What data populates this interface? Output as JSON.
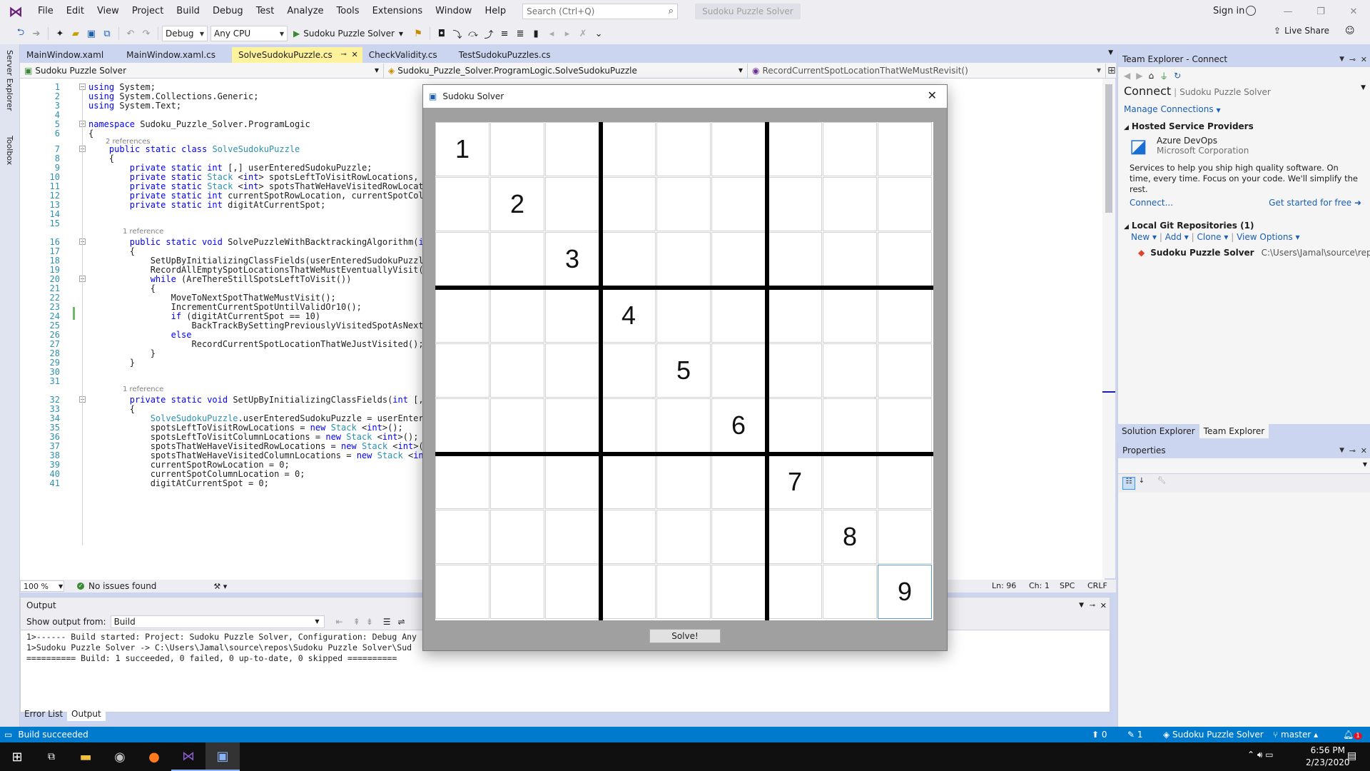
{
  "titlebar": {
    "menu": [
      "File",
      "Edit",
      "View",
      "Project",
      "Build",
      "Debug",
      "Test",
      "Analyze",
      "Tools",
      "Extensions",
      "Window",
      "Help"
    ],
    "search_placeholder": "Search (Ctrl+Q)",
    "solution_badge": "Sudoku Puzzle Solver",
    "sign_in": "Sign in"
  },
  "toolbar": {
    "config": "Debug",
    "platform": "Any CPU",
    "start_target": "Sudoku Puzzle Solver",
    "live_share": "Live Share"
  },
  "left_rail": {
    "server_explorer": "Server Explorer",
    "toolbox": "Toolbox"
  },
  "tabs": [
    "MainWindow.xaml",
    "MainWindow.xaml.cs",
    "SolveSudokuPuzzle.cs",
    "CheckValidity.cs",
    "TestSudokuPuzzles.cs"
  ],
  "active_tab": "SolveSudokuPuzzle.cs",
  "navbar": {
    "project": "Sudoku Puzzle Solver",
    "class": "Sudoku_Puzzle_Solver.ProgramLogic.SolveSudokuPuzzle",
    "member": "RecordCurrentSpotLocationThatWeMustRevisit()"
  },
  "code_lines": [
    {
      "n": "1",
      "t": "using System;"
    },
    {
      "n": "2",
      "t": "using System.Collections.Generic;"
    },
    {
      "n": "3",
      "t": "using System.Text;"
    },
    {
      "n": "4",
      "t": ""
    },
    {
      "n": "5",
      "t": "namespace Sudoku_Puzzle_Solver.ProgramLogic"
    },
    {
      "n": "6",
      "t": "{"
    },
    {
      "n": "7",
      "t": "    public static class SolveSudokuPuzzle"
    },
    {
      "n": "8",
      "t": "    {"
    },
    {
      "n": "9",
      "t": "        private static int [,] userEnteredSudokuPuzzle;"
    },
    {
      "n": "10",
      "t": "        private static Stack <int> spotsLeftToVisitRowLocations, sp"
    },
    {
      "n": "11",
      "t": "        private static Stack <int> spotsThatWeHaveVisitedRowLocatio"
    },
    {
      "n": "12",
      "t": "        private static int currentSpotRowLocation, currentSpotColum"
    },
    {
      "n": "13",
      "t": "        private static int digitAtCurrentSpot;"
    },
    {
      "n": "14",
      "t": ""
    },
    {
      "n": "15",
      "t": ""
    },
    {
      "n": "16",
      "t": "        public static void SolvePuzzleWithBacktrackingAlgorithm(int"
    },
    {
      "n": "17",
      "t": "        {"
    },
    {
      "n": "18",
      "t": "            SetUpByInitializingClassFields(userEnteredSudokuPuzzle)"
    },
    {
      "n": "19",
      "t": "            RecordAllEmptySpotLocationsThatWeMustEventuallyVisit();"
    },
    {
      "n": "20",
      "t": "            while (AreThereStillSpotsLeftToVisit())"
    },
    {
      "n": "21",
      "t": "            {"
    },
    {
      "n": "22",
      "t": "                MoveToNextSpotThatWeMustVisit();"
    },
    {
      "n": "23",
      "t": "                IncrementCurrentSpotUntilValidOr10();"
    },
    {
      "n": "24",
      "t": "                if (digitAtCurrentSpot == 10)"
    },
    {
      "n": "25",
      "t": "                    BackTrackBySettingPreviouslyVisitedSpotAsNextSp"
    },
    {
      "n": "26",
      "t": "                else"
    },
    {
      "n": "27",
      "t": "                    RecordCurrentSpotLocationThatWeJustVisited();"
    },
    {
      "n": "28",
      "t": "            }"
    },
    {
      "n": "29",
      "t": "        }"
    },
    {
      "n": "30",
      "t": ""
    },
    {
      "n": "31",
      "t": ""
    },
    {
      "n": "32",
      "t": "        private static void SetUpByInitializingClassFields(int [,]"
    },
    {
      "n": "33",
      "t": "        {"
    },
    {
      "n": "34",
      "t": "            SolveSudokuPuzzle.userEnteredSudokuPuzzle = userEntered"
    },
    {
      "n": "35",
      "t": "            spotsLeftToVisitRowLocations = new Stack <int>();"
    },
    {
      "n": "36",
      "t": "            spotsLeftToVisitColumnLocations = new Stack <int>();"
    },
    {
      "n": "37",
      "t": "            spotsThatWeHaveVisitedRowLocations = new Stack <int>();"
    },
    {
      "n": "38",
      "t": "            spotsThatWeHaveVisitedColumnLocations = new Stack <int>"
    },
    {
      "n": "39",
      "t": "            currentSpotRowLocation = 0;"
    },
    {
      "n": "40",
      "t": "            currentSpotColumnLocation = 0;"
    },
    {
      "n": "41",
      "t": "            digitAtCurrentSpot = 0;"
    }
  ],
  "codelens": {
    "ref2": "2 references",
    "ref1a": "1 reference",
    "ref1b": "1 reference"
  },
  "editor_status": {
    "zoom": "100 %",
    "issues": "No issues found",
    "ln": "Ln: 96",
    "ch": "Ch: 1",
    "spc": "SPC",
    "crlf": "CRLF"
  },
  "output": {
    "title": "Output",
    "show_from_label": "Show output from:",
    "source": "Build",
    "lines": [
      "1>------ Build started: Project: Sudoku Puzzle Solver, Configuration: Debug Any",
      "1>Sudoku Puzzle Solver -> C:\\Users\\Jamal\\source\\repos\\Sudoku Puzzle Solver\\Sud",
      "========== Build: 1 succeeded, 0 failed, 0 up-to-date, 0 skipped =========="
    ]
  },
  "bottom_tabs": [
    "Error List",
    "Output"
  ],
  "team_explorer": {
    "title": "Team Explorer - Connect",
    "connect": "Connect",
    "connect_sub": "Sudoku Puzzle Solver",
    "manage": "Manage Connections",
    "hosted": "Hosted Service Providers",
    "azure_name": "Azure DevOps",
    "azure_corp": "Microsoft Corporation",
    "azure_desc": "Services to help you ship high quality software. On time, every time. Focus on your code. We'll simplify the rest.",
    "connect_link": "Connect...",
    "get_started": "Get started for free",
    "local_repos": "Local Git Repositories (1)",
    "new": "New",
    "add": "Add",
    "clone": "Clone",
    "view_options": "View Options",
    "repo_name": "Sudoku Puzzle Solver",
    "repo_path": "C:\\Users\\Jamal\\source\\rep..."
  },
  "right_tabs": [
    "Solution Explorer",
    "Team Explorer"
  ],
  "properties": {
    "title": "Properties"
  },
  "statusbar": {
    "left": "Build succeeded",
    "up": "0",
    "pencil": "1",
    "solution": "Sudoku Puzzle Solver",
    "branch": "master",
    "notif": "1"
  },
  "taskbar": {
    "time": "6:56 PM",
    "date": "2/23/2020"
  },
  "sudoku": {
    "title": "Sudoku Solver",
    "solve_label": "Solve!",
    "grid": [
      [
        "1",
        "",
        "",
        "",
        "",
        "",
        "",
        "",
        ""
      ],
      [
        "",
        "2",
        "",
        "",
        "",
        "",
        "",
        "",
        ""
      ],
      [
        "",
        "",
        "3",
        "",
        "",
        "",
        "",
        "",
        ""
      ],
      [
        "",
        "",
        "",
        "4",
        "",
        "",
        "",
        "",
        ""
      ],
      [
        "",
        "",
        "",
        "",
        "5",
        "",
        "",
        "",
        ""
      ],
      [
        "",
        "",
        "",
        "",
        "",
        "6",
        "",
        "",
        ""
      ],
      [
        "",
        "",
        "",
        "",
        "",
        "",
        "7",
        "",
        ""
      ],
      [
        "",
        "",
        "",
        "",
        "",
        "",
        "",
        "8",
        ""
      ],
      [
        "",
        "",
        "",
        "",
        "",
        "",
        "",
        "",
        "9"
      ]
    ]
  },
  "colors": {
    "accent": "#007ACC",
    "active_tab": "#FFF29D",
    "keyword": "#0000FF",
    "type": "#2B91AF"
  }
}
